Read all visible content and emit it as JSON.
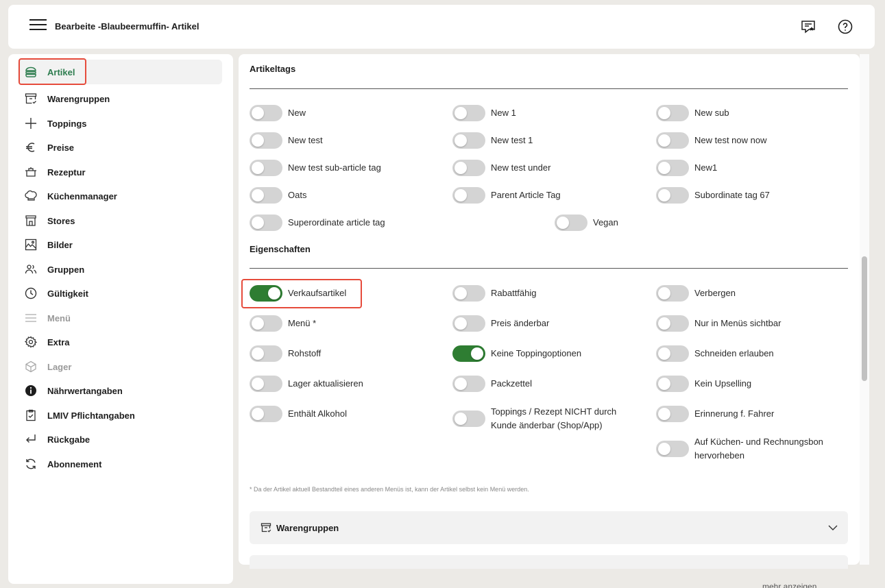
{
  "header": {
    "title": "Bearbeite -Blaubeermuffin- Artikel",
    "menu_icon": "hamburger-icon",
    "review_icon": "message-star-icon",
    "help_icon": "help-circle-icon"
  },
  "sidebar": {
    "items": [
      {
        "label": "Artikel",
        "icon": "burger-icon",
        "active": true
      },
      {
        "label": "Warengruppen",
        "icon": "box-icon"
      },
      {
        "label": "Toppings",
        "icon": "plus-icon"
      },
      {
        "label": "Preise",
        "icon": "euro-icon"
      },
      {
        "label": "Rezeptur",
        "icon": "pot-icon"
      },
      {
        "label": "Küchenmanager",
        "icon": "chef-hat-icon"
      },
      {
        "label": "Stores",
        "icon": "store-icon"
      },
      {
        "label": "Bilder",
        "icon": "image-icon"
      },
      {
        "label": "Gruppen",
        "icon": "users-icon"
      },
      {
        "label": "Gültigkeit",
        "icon": "clock-icon"
      },
      {
        "label": "Menü",
        "icon": "list-icon",
        "disabled": true
      },
      {
        "label": "Extra",
        "icon": "gear-icon"
      },
      {
        "label": "Lager",
        "icon": "cube-icon",
        "disabled": true
      },
      {
        "label": "Nährwertangaben",
        "icon": "info-icon"
      },
      {
        "label": "LMIV Pflichtangaben",
        "icon": "clipboard-check-icon"
      },
      {
        "label": "Rückgabe",
        "icon": "return-icon"
      },
      {
        "label": "Abonnement",
        "icon": "refresh-icon"
      }
    ]
  },
  "artikeltags": {
    "title": "Artikeltags",
    "tags": [
      {
        "label": "New",
        "on": false
      },
      {
        "label": "New 1",
        "on": false
      },
      {
        "label": "New sub",
        "on": false
      },
      {
        "label": "New test",
        "on": false
      },
      {
        "label": "New test 1",
        "on": false
      },
      {
        "label": "New test now now",
        "on": false
      },
      {
        "label": "New test sub-article tag",
        "on": false
      },
      {
        "label": "New test under",
        "on": false
      },
      {
        "label": "New1",
        "on": false
      },
      {
        "label": "Oats",
        "on": false
      },
      {
        "label": "Parent Article Tag",
        "on": false
      },
      {
        "label": "Subordinate tag 67",
        "on": false
      },
      {
        "label": "Superordinate article tag",
        "on": false
      },
      {
        "label": "Vegan",
        "on": false
      }
    ]
  },
  "eigenschaften": {
    "title": "Eigenschaften",
    "props": [
      {
        "label": "Verkaufsartikel",
        "on": true
      },
      {
        "label": "Rabattfähig",
        "on": false
      },
      {
        "label": "Verbergen",
        "on": false
      },
      {
        "label": "Menü *",
        "on": false
      },
      {
        "label": "Preis änderbar",
        "on": false
      },
      {
        "label": "Nur in Menüs sichtbar",
        "on": false
      },
      {
        "label": "Rohstoff",
        "on": false
      },
      {
        "label": "Keine Toppingoptionen",
        "on": true
      },
      {
        "label": "Schneiden erlauben",
        "on": false
      },
      {
        "label": "Lager aktualisieren",
        "on": false
      },
      {
        "label": "Packzettel",
        "on": false
      },
      {
        "label": "Kein Upselling",
        "on": false
      },
      {
        "label": "Enthält Alkohol",
        "on": false
      },
      {
        "label": "Toppings / Rezept NICHT durch Kunde änderbar (Shop/App)",
        "on": false
      },
      {
        "label": "Erinnerung f. Fahrer",
        "on": false
      },
      {
        "label": "Auf Küchen- und Rechnungsbon hervorheben",
        "on": false
      }
    ]
  },
  "footnote": "* Da der Artikel aktuell Bestandteil eines anderen Menüs ist, kann der Artikel selbst kein Menü werden.",
  "accordion": {
    "label": "Warengruppen",
    "icon": "box-icon"
  },
  "more_link": "mehr anzeigen"
}
